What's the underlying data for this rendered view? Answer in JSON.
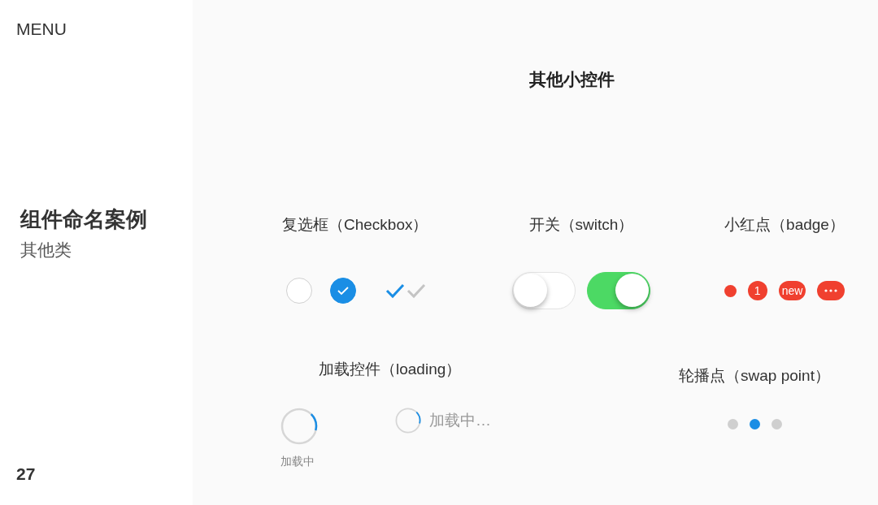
{
  "sidebar": {
    "menu": "MENU",
    "title": "组件命名案例",
    "subtitle": "其他类",
    "page": "27"
  },
  "heading": "其他小控件",
  "checkbox": {
    "title": "复选框（Checkbox）",
    "items": [
      {
        "kind": "circle",
        "checked": false
      },
      {
        "kind": "circle",
        "checked": true
      },
      {
        "kind": "tick",
        "checked": true
      },
      {
        "kind": "tick",
        "checked": false
      }
    ]
  },
  "switch": {
    "title": "开关（switch）",
    "items": [
      {
        "on": false
      },
      {
        "on": true
      }
    ]
  },
  "badge": {
    "title": "小红点（badge）",
    "items": [
      {
        "kind": "dot"
      },
      {
        "kind": "count",
        "text": "1"
      },
      {
        "kind": "count",
        "text": "new"
      },
      {
        "kind": "more"
      }
    ]
  },
  "loading": {
    "title": "加载控件（loading）",
    "items": [
      {
        "kind": "stacked",
        "label": "加载中"
      },
      {
        "kind": "inline",
        "label": "加载中…"
      }
    ]
  },
  "swap": {
    "title": "轮播点（swap point）",
    "dots": [
      {
        "selected": false
      },
      {
        "selected": true
      },
      {
        "selected": false
      }
    ]
  }
}
